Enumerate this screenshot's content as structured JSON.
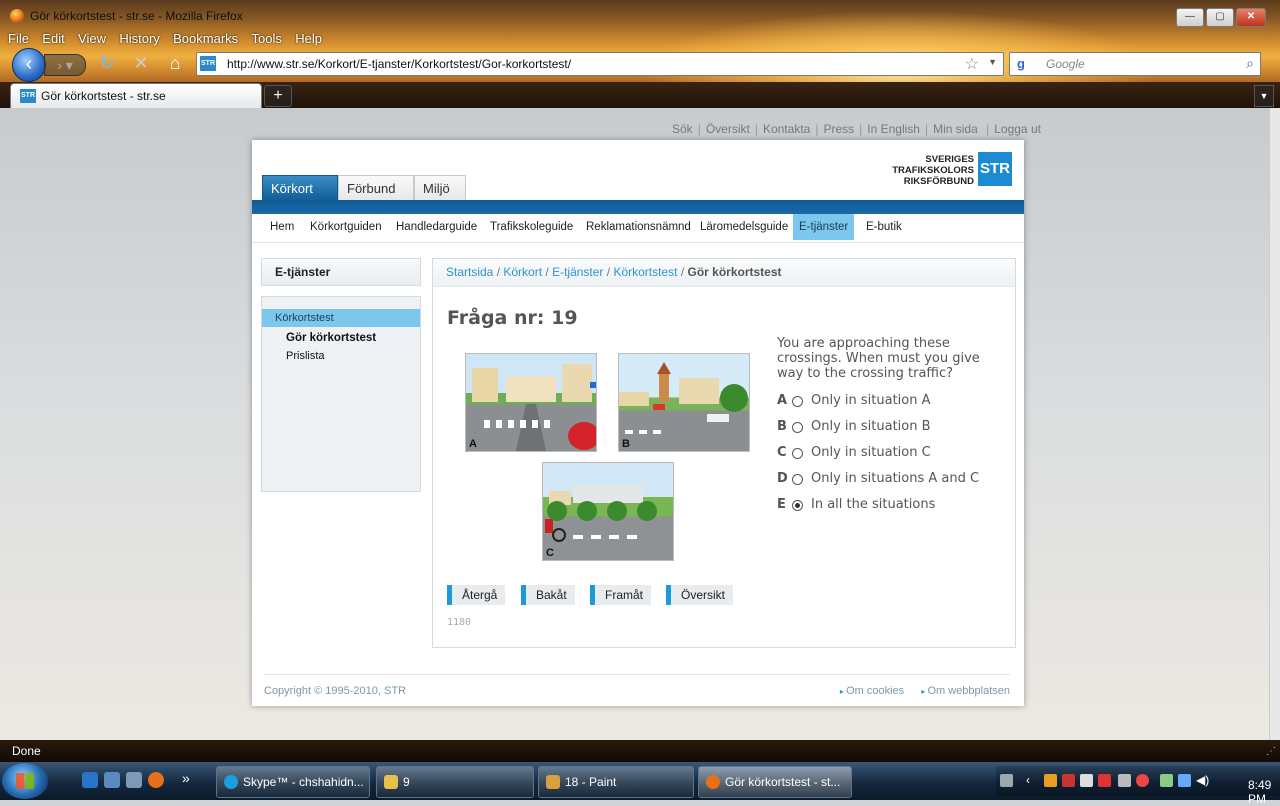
{
  "window": {
    "title": "Gör körkortstest - str.se - Mozilla Firefox",
    "controls": {
      "minimize": "—",
      "maximize": "▢",
      "close": "✕"
    }
  },
  "menu": [
    "File",
    "Edit",
    "View",
    "History",
    "Bookmarks",
    "Tools",
    "Help"
  ],
  "nav": {
    "url": "http://www.str.se/Korkort/E-tjanster/Korkortstest/Gor-korkortstest/",
    "search_placeholder": "Google",
    "site_icon": "STR"
  },
  "tabs": [
    {
      "label": "Gör körkortstest - str.se",
      "icon": "STR"
    }
  ],
  "site": {
    "top_links": [
      "Sök",
      "Översikt",
      "Kontakta",
      "Press",
      "In English",
      "Min sida",
      "Logga ut"
    ],
    "main_tabs": [
      "Körkort",
      "Förbund",
      "Miljö"
    ],
    "logo": {
      "line1": "SVERIGES",
      "line2": "TRAFIKSKOLORS",
      "line3": "RIKSFÖRBUND",
      "mark": "STR"
    },
    "subnav": [
      "Hem",
      "Körkortguiden",
      "Handledarguide",
      "Trafikskoleguide",
      "Reklamationsnämnd",
      "Läromedelsguide",
      "E-tjänster",
      "E-butik"
    ],
    "subnav_active": "E-tjänster",
    "sidebar": {
      "title": "E-tjänster",
      "section": "Körkortstest",
      "items": [
        "Gör körkortstest",
        "Prislista"
      ]
    },
    "breadcrumb": {
      "links": [
        "Startsida",
        "Körkort",
        "E-tjänster",
        "Körkortstest"
      ],
      "current": "Gör körkortstest"
    },
    "question": {
      "title": "Fråga nr: 19",
      "text": "You are approaching these crossings. When must you give way to the crossing traffic?",
      "images": [
        "A",
        "B",
        "C"
      ],
      "options": [
        {
          "letter": "A",
          "text": "Only in situation A",
          "selected": false
        },
        {
          "letter": "B",
          "text": "Only in situation B",
          "selected": false
        },
        {
          "letter": "C",
          "text": "Only in situation C",
          "selected": false
        },
        {
          "letter": "D",
          "text": "Only in situations A and C",
          "selected": false
        },
        {
          "letter": "E",
          "text": "In all the situations",
          "selected": true
        }
      ],
      "buttons": [
        "Återgå",
        "Bakåt",
        "Framåt",
        "Översikt"
      ],
      "id": "1180"
    },
    "footer": {
      "copyright": "Copyright © 1995-2010, STR",
      "links": [
        "Om cookies",
        "Om webbplatsen"
      ]
    }
  },
  "status": "Done",
  "taskbar": {
    "buttons": [
      "Skype™ - chshahidn...",
      "9",
      "18 - Paint",
      "Gör körkortstest - st..."
    ],
    "chevron": "»",
    "clock": "8:49 PM"
  },
  "colors": {
    "accent": "#1d8bd1",
    "nav_dark": "#0e5a96",
    "active_light": "#7cc7ee",
    "link": "#2b95cf"
  }
}
